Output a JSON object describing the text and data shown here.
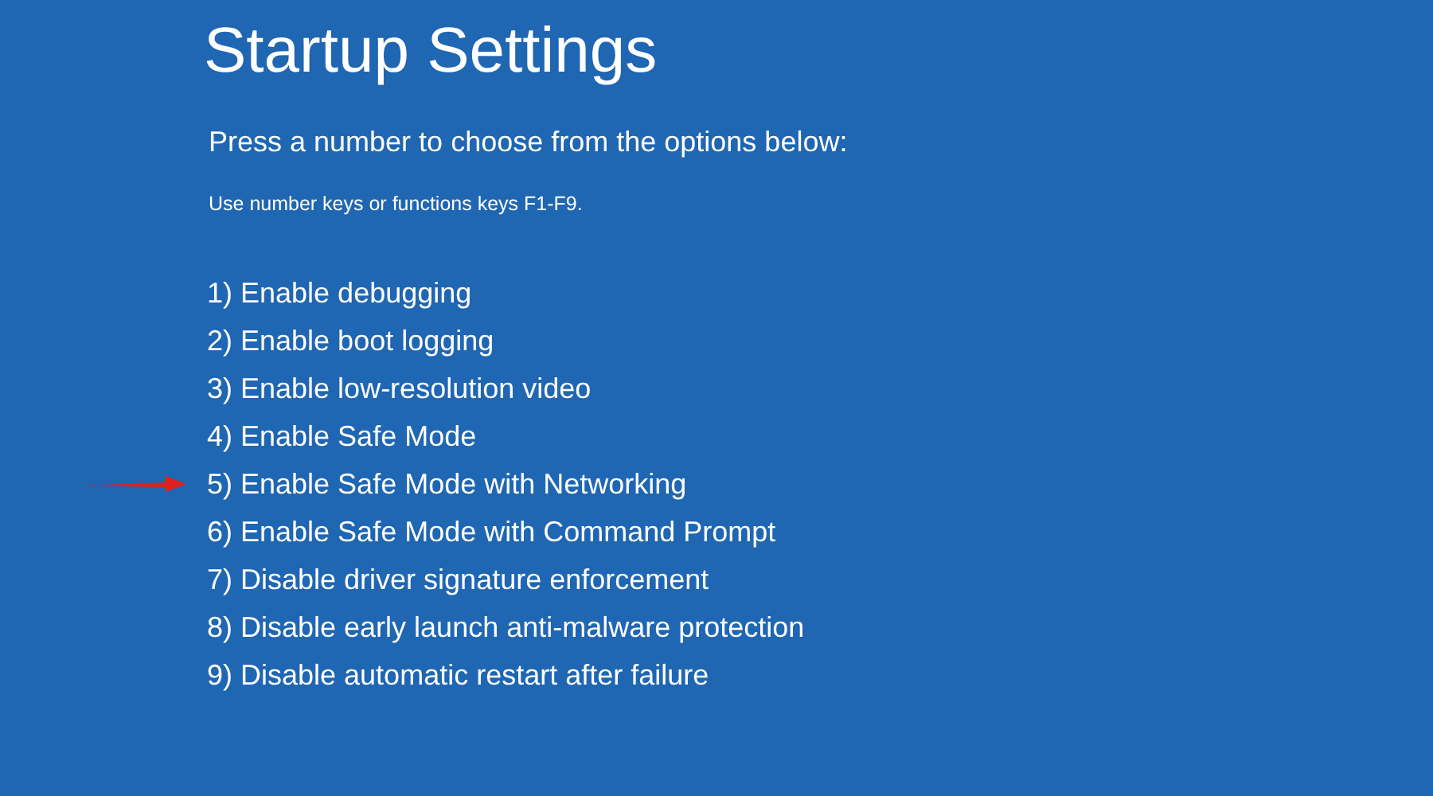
{
  "title": "Startup Settings",
  "prompt": "Press a number to choose from the options below:",
  "hint": "Use number keys or functions keys F1-F9.",
  "options": [
    {
      "label": "1) Enable debugging",
      "marked": false
    },
    {
      "label": "2) Enable boot logging",
      "marked": false
    },
    {
      "label": "3) Enable low-resolution video",
      "marked": false
    },
    {
      "label": "4) Enable Safe Mode",
      "marked": false
    },
    {
      "label": "5) Enable Safe Mode with Networking",
      "marked": true
    },
    {
      "label": "6) Enable Safe Mode with Command Prompt",
      "marked": false
    },
    {
      "label": "7) Disable driver signature enforcement",
      "marked": false
    },
    {
      "label": "8) Disable early launch anti-malware protection",
      "marked": false
    },
    {
      "label": "9) Disable automatic restart after failure",
      "marked": false
    }
  ]
}
